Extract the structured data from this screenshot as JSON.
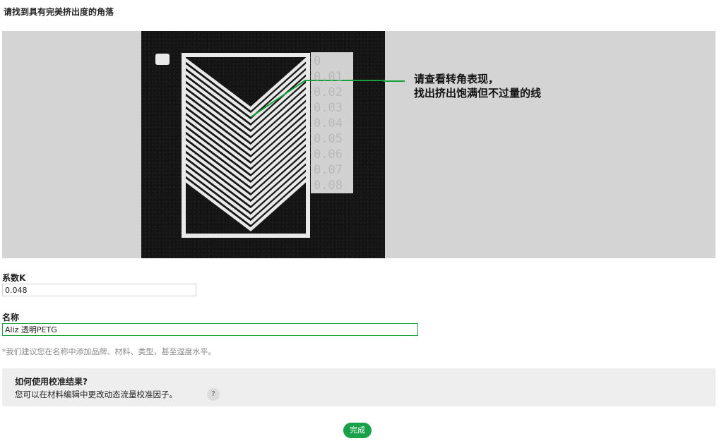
{
  "page": {
    "title": "请找到具有完美挤出度的角落"
  },
  "preview": {
    "callout_line1": "请查看转角表现，",
    "callout_line2": "找出挤出饱满但不过量的线",
    "scale_labels": [
      "0",
      "0.01",
      "0.02",
      "0.03",
      "0.04",
      "0.05",
      "0.06",
      "0.07",
      "0.08"
    ],
    "accent": "#18a03c"
  },
  "fields": {
    "k_label": "系数K",
    "k_value": "0.048",
    "name_label": "名称",
    "name_value": "Aliz 透明PETG"
  },
  "hint": "*我们建议您在名称中添加品牌、材料、类型，甚至湿度水平。",
  "help": {
    "title": "如何使用校准结果?",
    "text": "您可以在材料编辑中更改动态流量校准因子。",
    "button": "?"
  },
  "actions": {
    "done": "完成"
  },
  "colors": {
    "accent": "#1aa048",
    "preview_bg": "#d4d4d4"
  }
}
